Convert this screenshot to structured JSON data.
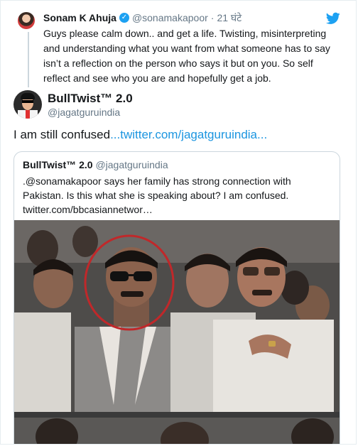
{
  "parent_tweet": {
    "name": "Sonam K Ahuja",
    "handle": "@sonamakapoor",
    "separator": "·",
    "time": "21 घंटे",
    "text": "Guys please calm down.. and get a life. Twisting, misinterpreting and understanding what you want from what someone has to say isn’t a reflection on the person who says it but on you. So self reflect and see who you are and hopefully get a job.",
    "verified_icon": "verified-check-icon",
    "brand_icon": "twitter-bird-icon"
  },
  "reply_tweet": {
    "name": "BullTwist™ 2.0",
    "handle": "@jagatguruindia",
    "text": "I am still confused",
    "link": "...twitter.com/jagatguruindia..."
  },
  "quoted_tweet": {
    "name": "BullTwist™ 2.0",
    "handle": "@jagatguruindia",
    "text": ".@sonamakapoor says her family has strong connection with Pakistan. Is this what she is speaking about? I am confused. twitter.com/bbcasiannetwor…"
  },
  "colors": {
    "link": "#1b95e0",
    "verified": "#1da1f2",
    "muted": "#657786",
    "highlight_circle": "#c0282a"
  }
}
